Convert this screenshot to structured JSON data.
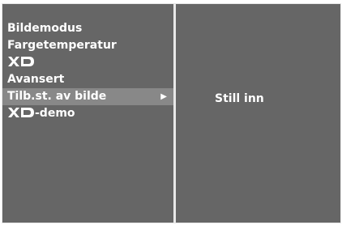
{
  "menu": {
    "items": [
      {
        "label": "Bildemodus"
      },
      {
        "label": "Fargetemperatur"
      },
      {
        "logo": "XD"
      },
      {
        "label": "Avansert"
      },
      {
        "label": "Tilb.st. av bilde",
        "selected": true,
        "arrow": "▶"
      },
      {
        "logo": "XD",
        "label": "-demo"
      }
    ]
  },
  "submenu": {
    "value": "Still inn"
  },
  "icons": {
    "xd_logo": "xd-logo-icon",
    "submenu_arrow": "right-triangle-icon"
  },
  "colors": {
    "panel_bg": "#666666",
    "selected_bg": "#888888",
    "divider": "#e8e8e8",
    "text": "#ffffff"
  }
}
